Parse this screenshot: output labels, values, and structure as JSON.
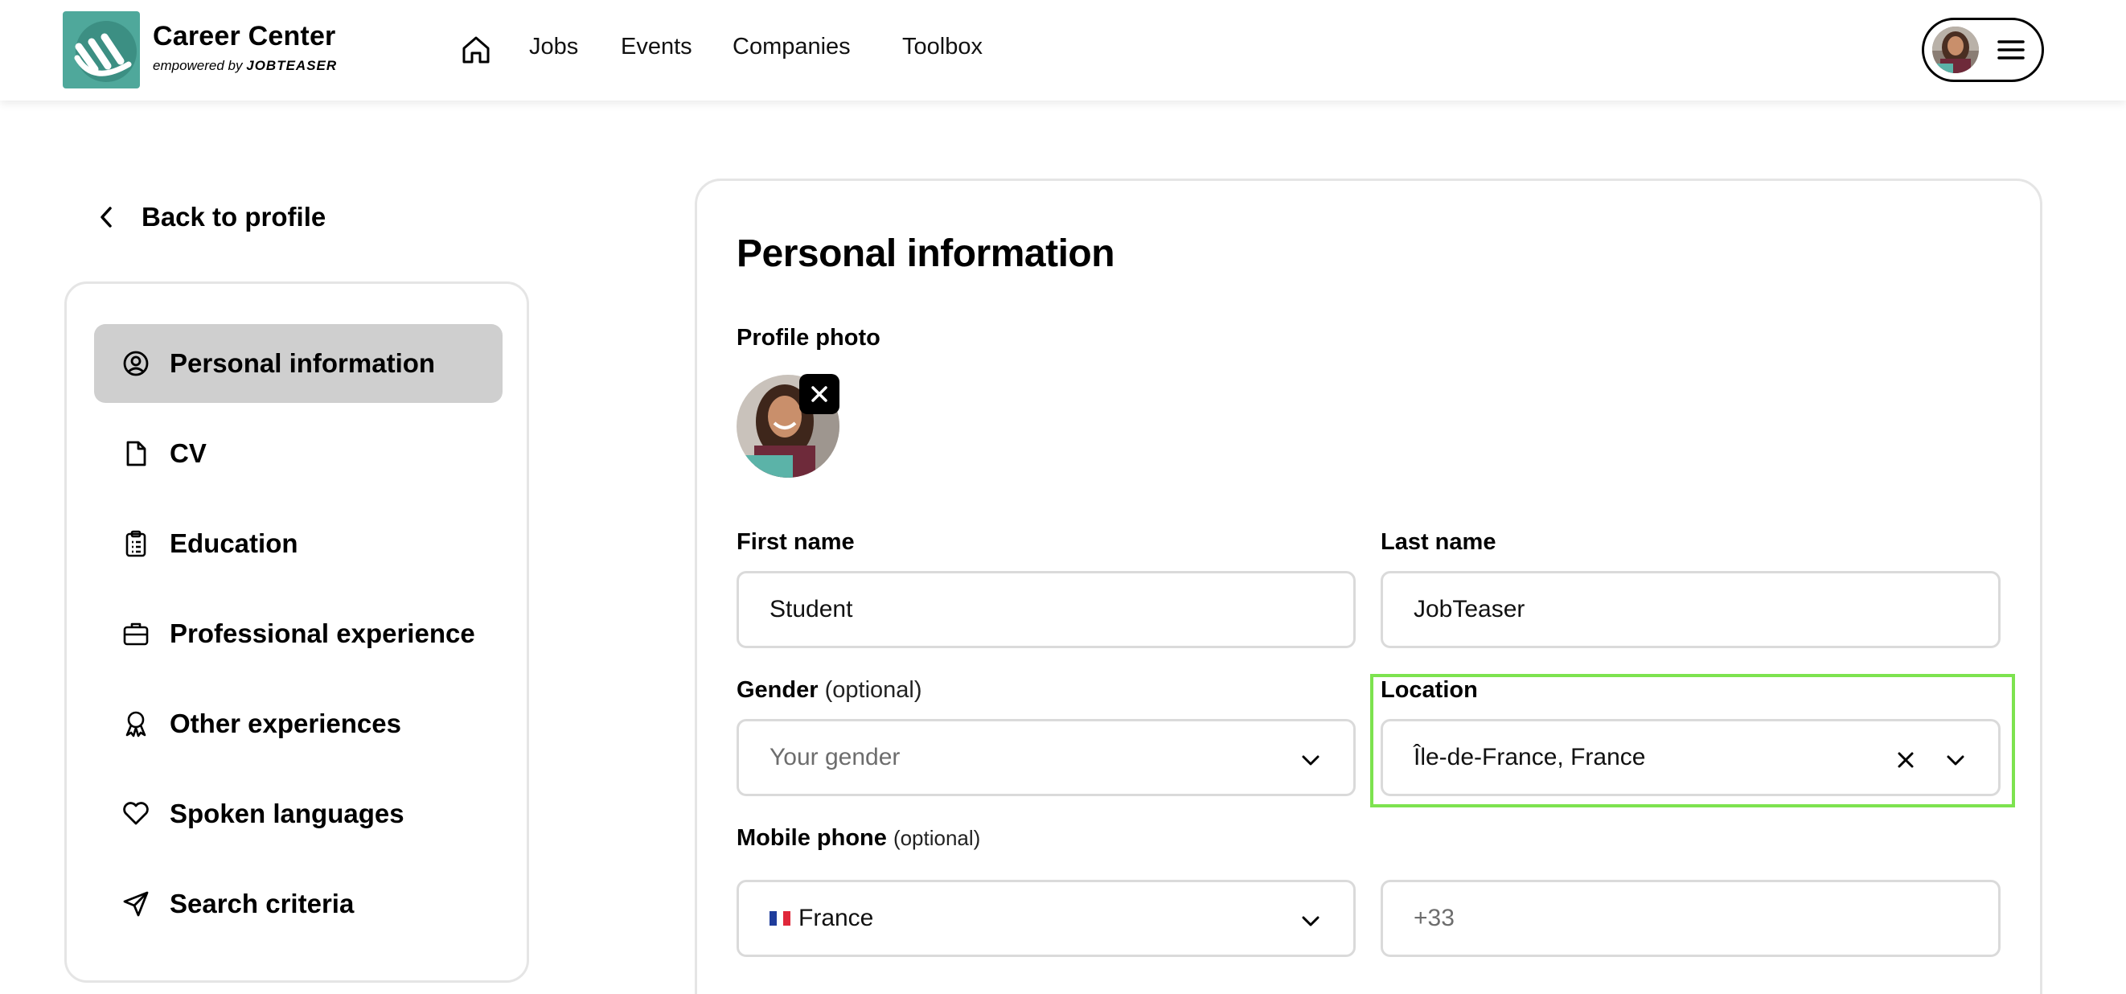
{
  "header": {
    "brand_title": "Career Center",
    "brand_sub_prefix": "empowered by",
    "brand_sub_name": "JOBTEASER",
    "nav": [
      "Jobs",
      "Events",
      "Companies",
      "Toolbox"
    ],
    "icons": [
      "home-icon",
      "menu-icon"
    ]
  },
  "back_label": "Back to profile",
  "sidebar": {
    "items": [
      {
        "label": "Personal information",
        "icon": "user-circle-icon",
        "active": true
      },
      {
        "label": "CV",
        "icon": "file-icon"
      },
      {
        "label": "Education",
        "icon": "clipboard-icon"
      },
      {
        "label": "Professional experience",
        "icon": "briefcase-icon"
      },
      {
        "label": "Other experiences",
        "icon": "award-icon"
      },
      {
        "label": "Spoken languages",
        "icon": "heart-icon"
      },
      {
        "label": "Search criteria",
        "icon": "send-icon"
      }
    ]
  },
  "form": {
    "title": "Personal information",
    "profile_photo_label": "Profile photo",
    "first_name": {
      "label": "First name",
      "value": "Student"
    },
    "last_name": {
      "label": "Last name",
      "value": "JobTeaser"
    },
    "gender": {
      "label": "Gender",
      "optional": "(optional)",
      "placeholder": "Your gender"
    },
    "location": {
      "label": "Location",
      "value": "Île-de-France, France"
    },
    "mobile": {
      "label": "Mobile phone",
      "optional": "(optional)",
      "country": "France",
      "placeholder": "+33"
    }
  },
  "colors": {
    "brand": "#4fa89b",
    "highlight": "#7de34f",
    "active_item": "#cfcfcf"
  }
}
